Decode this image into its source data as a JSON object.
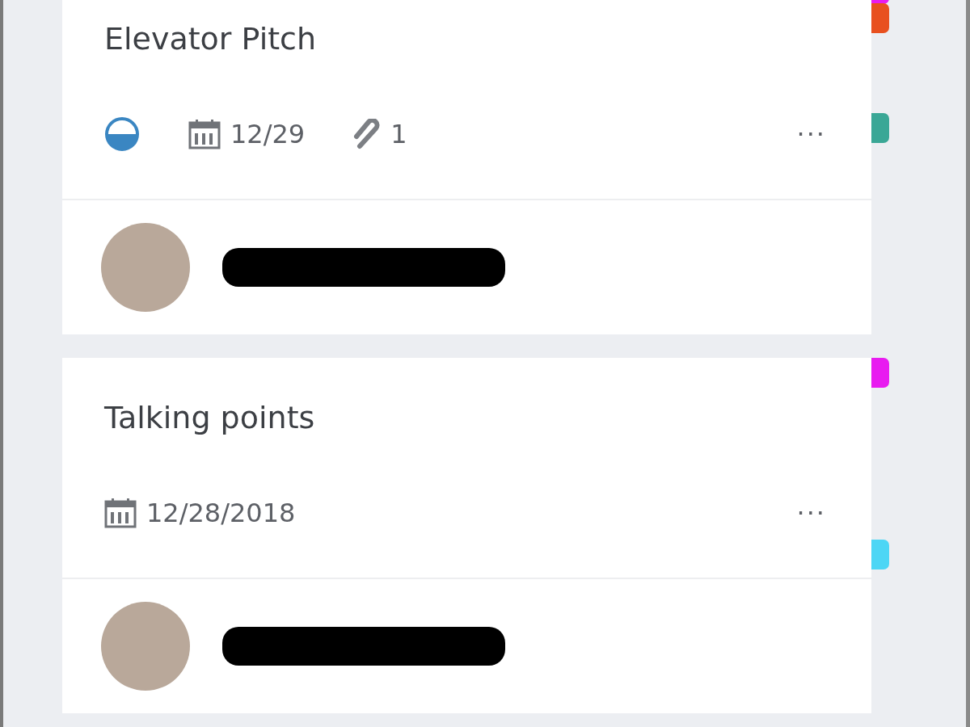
{
  "cards": [
    {
      "title": "Elevator Pitch",
      "in_progress": true,
      "due": "12/29",
      "attachments": "1",
      "more": "···",
      "assignee": {
        "name_redacted": true
      },
      "labels": [
        {
          "color": "#e81bf0"
        },
        {
          "color": "#e8501f"
        },
        {
          "color": "#3aa796"
        }
      ]
    },
    {
      "title": "Talking points",
      "due": "12/28/2018",
      "more": "···",
      "assignee": {
        "name_redacted": true
      },
      "labels": [
        {
          "color": "#e81bf0"
        },
        {
          "color": "#4dd6f5"
        }
      ]
    }
  ]
}
